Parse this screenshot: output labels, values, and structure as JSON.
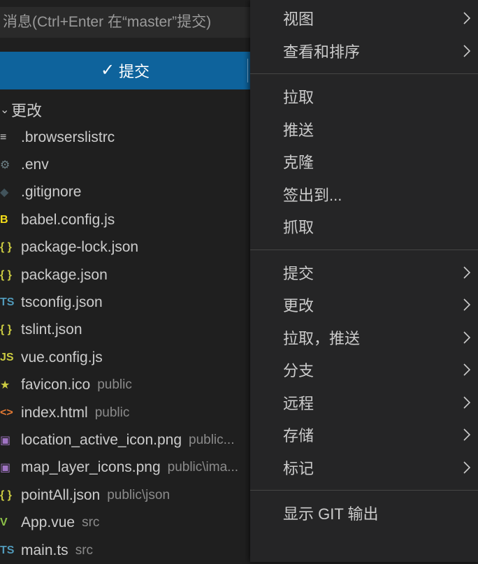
{
  "scm": {
    "message_placeholder": "消息(Ctrl+Enter 在“master”提交)",
    "commit_check": "✓",
    "commit_label": "提交",
    "changes_chevron": "✓",
    "changes_label": "更改",
    "files": [
      {
        "icon": "lines-icon",
        "glyph": "≡",
        "color": "#cccccc",
        "name": ".browserslistrc",
        "dir": ""
      },
      {
        "icon": "gear-icon",
        "glyph": "⚙",
        "color": "#6d8086",
        "name": ".env",
        "dir": ""
      },
      {
        "icon": "git-diamond-icon",
        "glyph": "◆",
        "color": "#41535b",
        "name": ".gitignore",
        "dir": ""
      },
      {
        "icon": "babel-icon",
        "glyph": "B",
        "color": "#f5de19",
        "name": "babel.config.js",
        "dir": ""
      },
      {
        "icon": "json-braces-icon",
        "glyph": "{ }",
        "color": "#cbcb41",
        "name": "package-lock.json",
        "dir": ""
      },
      {
        "icon": "json-braces-icon",
        "glyph": "{ }",
        "color": "#cbcb41",
        "name": "package.json",
        "dir": ""
      },
      {
        "icon": "typescript-icon",
        "glyph": "TS",
        "color": "#519aba",
        "name": "tsconfig.json",
        "dir": ""
      },
      {
        "icon": "json-braces-icon",
        "glyph": "{ }",
        "color": "#cbcb41",
        "name": "tslint.json",
        "dir": ""
      },
      {
        "icon": "javascript-icon",
        "glyph": "JS",
        "color": "#cbcb41",
        "name": "vue.config.js",
        "dir": ""
      },
      {
        "icon": "star-icon",
        "glyph": "★",
        "color": "#cbcb41",
        "name": "favicon.ico",
        "dir": "public"
      },
      {
        "icon": "html-icon",
        "glyph": "<>",
        "color": "#e37933",
        "name": "index.html",
        "dir": "public"
      },
      {
        "icon": "image-icon",
        "glyph": "▣",
        "color": "#a074c4",
        "name": "location_active_icon.png",
        "dir": "public..."
      },
      {
        "icon": "image-icon",
        "glyph": "▣",
        "color": "#a074c4",
        "name": "map_layer_icons.png",
        "dir": "public\\ima..."
      },
      {
        "icon": "json-braces-icon",
        "glyph": "{ }",
        "color": "#cbcb41",
        "name": "pointAll.json",
        "dir": "public\\json"
      },
      {
        "icon": "vue-icon",
        "glyph": "V",
        "color": "#8dc149",
        "name": "App.vue",
        "dir": "src"
      },
      {
        "icon": "typescript-icon",
        "glyph": "TS",
        "color": "#519aba",
        "name": "main.ts",
        "dir": "src"
      }
    ]
  },
  "menu": {
    "groups": [
      [
        {
          "label": "视图",
          "submenu": true
        },
        {
          "label": "查看和排序",
          "submenu": true
        }
      ],
      [
        {
          "label": "拉取",
          "submenu": false
        },
        {
          "label": "推送",
          "submenu": false
        },
        {
          "label": "克隆",
          "submenu": false
        },
        {
          "label": "签出到...",
          "submenu": false
        },
        {
          "label": "抓取",
          "submenu": false
        }
      ],
      [
        {
          "label": "提交",
          "submenu": true
        },
        {
          "label": "更改",
          "submenu": true
        },
        {
          "label": "拉取，推送",
          "submenu": true
        },
        {
          "label": "分支",
          "submenu": true
        },
        {
          "label": "远程",
          "submenu": true
        },
        {
          "label": "存储",
          "submenu": true
        },
        {
          "label": "标记",
          "submenu": true
        }
      ],
      [
        {
          "label": "显示 GIT 输出",
          "submenu": false
        }
      ]
    ],
    "submenu_arrow": "›"
  }
}
